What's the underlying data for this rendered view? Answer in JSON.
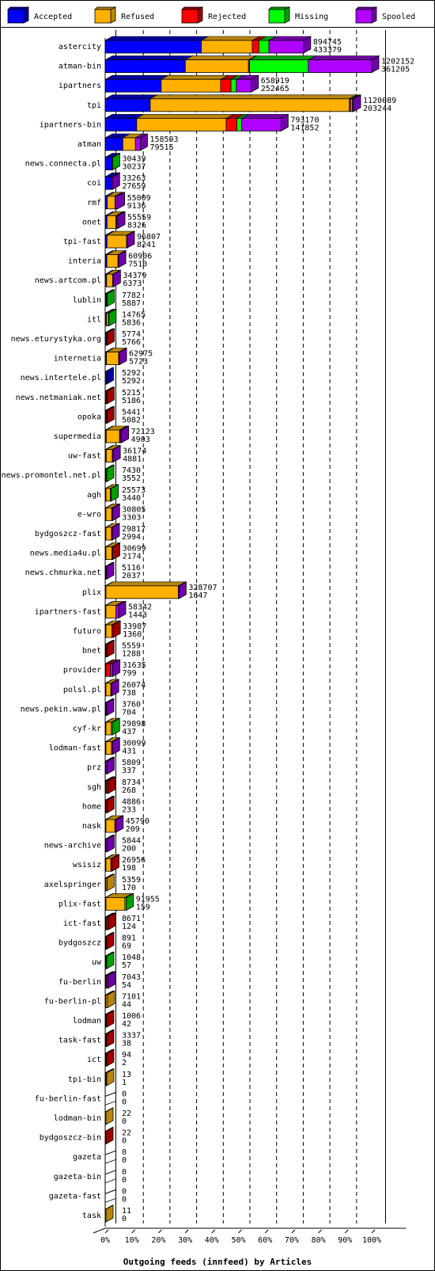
{
  "chart_data": {
    "type": "bar",
    "orientation": "horizontal",
    "stacked": true,
    "title": "",
    "xlabel": "Outgoing feeds (innfeed) by Articles",
    "ylabel": "",
    "x_unit": "percent of maximum total",
    "xlim": [
      0,
      100
    ],
    "x_ticks": [
      "0%",
      "10%",
      "20%",
      "30%",
      "40%",
      "50%",
      "60%",
      "70%",
      "80%",
      "90%",
      "100%"
    ],
    "grid": true,
    "legend_position": "top",
    "legend": [
      {
        "name": "Accepted",
        "color": "#0000ff",
        "shade": "#0000a0"
      },
      {
        "name": "Refused",
        "color": "#ffb000",
        "shade": "#b8860b"
      },
      {
        "name": "Rejected",
        "color": "#ff0000",
        "shade": "#a00000"
      },
      {
        "name": "Missing",
        "color": "#00ff00",
        "shade": "#00a000"
      },
      {
        "name": "Spooled",
        "color": "#b000ff",
        "shade": "#7000a8"
      }
    ],
    "max_total": 1202152,
    "categories": [
      {
        "name": "astercity",
        "top": "894745",
        "bottom": "433379",
        "seg": [
          433379,
          230000,
          30000,
          45000,
          156366
        ]
      },
      {
        "name": "atman-bin",
        "top": "1202152",
        "bottom": "361205",
        "seg": [
          361205,
          285000,
          5000,
          265000,
          285947
        ]
      },
      {
        "name": "ipartners",
        "top": "658919",
        "bottom": "252465",
        "seg": [
          252465,
          268000,
          47000,
          24000,
          67454
        ]
      },
      {
        "name": "tpi",
        "top": "1120089",
        "bottom": "203244",
        "seg": [
          203244,
          898000,
          6000,
          8000,
          4845
        ]
      },
      {
        "name": "ipartners-bin",
        "top": "793170",
        "bottom": "141852",
        "seg": [
          141852,
          404000,
          48000,
          21000,
          178318
        ]
      },
      {
        "name": "atman",
        "top": "158593",
        "bottom": "79515",
        "seg": [
          79515,
          57000,
          0,
          0,
          22078
        ]
      },
      {
        "name": "news.connecta.pl",
        "top": "30439",
        "bottom": "30237",
        "seg": [
          30237,
          0,
          0,
          202,
          0
        ]
      },
      {
        "name": "coi",
        "top": "33263",
        "bottom": "27659",
        "seg": [
          27659,
          0,
          0,
          0,
          5604
        ]
      },
      {
        "name": "rmf",
        "top": "55009",
        "bottom": "9136",
        "seg": [
          9136,
          35000,
          3000,
          0,
          7873
        ]
      },
      {
        "name": "onet",
        "top": "55559",
        "bottom": "8326",
        "seg": [
          8326,
          40000,
          2000,
          0,
          5233
        ]
      },
      {
        "name": "tpi-fast",
        "top": "96807",
        "bottom": "8241",
        "seg": [
          8241,
          88000,
          0,
          0,
          566
        ]
      },
      {
        "name": "interia",
        "top": "60906",
        "bottom": "7510",
        "seg": [
          7510,
          50000,
          0,
          0,
          3396
        ]
      },
      {
        "name": "news.artcom.pl",
        "top": "34379",
        "bottom": "6373",
        "seg": [
          6373,
          27000,
          0,
          0,
          1006
        ]
      },
      {
        "name": "lublin",
        "top": "7782",
        "bottom": "5887",
        "seg": [
          5887,
          0,
          0,
          1895,
          0
        ]
      },
      {
        "name": "itl",
        "top": "14765",
        "bottom": "5836",
        "seg": [
          5836,
          8000,
          0,
          929,
          0
        ]
      },
      {
        "name": "news.eturystyka.org",
        "top": "5774",
        "bottom": "5766",
        "seg": [
          5766,
          0,
          8,
          0,
          0
        ]
      },
      {
        "name": "internetia",
        "top": "62975",
        "bottom": "5723",
        "seg": [
          5723,
          55000,
          0,
          0,
          2252
        ]
      },
      {
        "name": "news.intertele.pl",
        "top": "5292",
        "bottom": "5292",
        "seg": [
          5292,
          0,
          0,
          0,
          0
        ]
      },
      {
        "name": "news.netmaniak.net",
        "top": "5215",
        "bottom": "5186",
        "seg": [
          5186,
          0,
          29,
          0,
          0
        ]
      },
      {
        "name": "opoka",
        "top": "5441",
        "bottom": "5082",
        "seg": [
          5082,
          0,
          359,
          0,
          0
        ]
      },
      {
        "name": "supermedia",
        "top": "72123",
        "bottom": "4903",
        "seg": [
          4903,
          60000,
          2000,
          0,
          5220
        ]
      },
      {
        "name": "uw-fast",
        "top": "36174",
        "bottom": "4881",
        "seg": [
          4881,
          27000,
          0,
          0,
          4293
        ]
      },
      {
        "name": "news.promontel.net.pl",
        "top": "7430",
        "bottom": "3552",
        "seg": [
          3552,
          0,
          0,
          3878,
          0
        ]
      },
      {
        "name": "agh",
        "top": "25573",
        "bottom": "3440",
        "seg": [
          3440,
          20000,
          0,
          2133,
          0
        ]
      },
      {
        "name": "e-wro",
        "top": "30805",
        "bottom": "3303",
        "seg": [
          3303,
          26000,
          0,
          0,
          1502
        ]
      },
      {
        "name": "bydgoszcz-fast",
        "top": "29817",
        "bottom": "2994",
        "seg": [
          2994,
          25000,
          0,
          0,
          1823
        ]
      },
      {
        "name": "news.media4u.pl",
        "top": "30699",
        "bottom": "2174",
        "seg": [
          2174,
          27000,
          1525,
          0,
          0
        ]
      },
      {
        "name": "news.chmurka.net",
        "top": "5116",
        "bottom": "2037",
        "seg": [
          2037,
          0,
          0,
          0,
          3079
        ]
      },
      {
        "name": "plix",
        "top": "328707",
        "bottom": "1647",
        "seg": [
          1647,
          326000,
          0,
          0,
          1060
        ]
      },
      {
        "name": "ipartners-fast",
        "top": "58342",
        "bottom": "1443",
        "seg": [
          1443,
          45000,
          0,
          0,
          11899
        ]
      },
      {
        "name": "futuro",
        "top": "33987",
        "bottom": "1360",
        "seg": [
          1360,
          27000,
          5627,
          0,
          0
        ]
      },
      {
        "name": "bnet",
        "top": "5559",
        "bottom": "1288",
        "seg": [
          1288,
          0,
          4271,
          0,
          0
        ]
      },
      {
        "name": "provider",
        "top": "31635",
        "bottom": "799",
        "seg": [
          799,
          0,
          20000,
          0,
          10836
        ]
      },
      {
        "name": "polsl.pl",
        "top": "26074",
        "bottom": "738",
        "seg": [
          738,
          22000,
          0,
          0,
          3336
        ]
      },
      {
        "name": "news.pekin.waw.pl",
        "top": "3760",
        "bottom": "704",
        "seg": [
          704,
          0,
          0,
          0,
          3056
        ]
      },
      {
        "name": "cyf-kr",
        "top": "29898",
        "bottom": "437",
        "seg": [
          437,
          24000,
          0,
          5461,
          0
        ]
      },
      {
        "name": "lodman-fast",
        "top": "30099",
        "bottom": "431",
        "seg": [
          431,
          25000,
          0,
          0,
          4668
        ]
      },
      {
        "name": "prz",
        "top": "5809",
        "bottom": "337",
        "seg": [
          337,
          0,
          0,
          0,
          5472
        ]
      },
      {
        "name": "sgh",
        "top": "8734",
        "bottom": "268",
        "seg": [
          268,
          1500,
          6966,
          0,
          0
        ]
      },
      {
        "name": "home",
        "top": "4886",
        "bottom": "233",
        "seg": [
          233,
          0,
          4653,
          0,
          0
        ]
      },
      {
        "name": "nask",
        "top": "45790",
        "bottom": "209",
        "seg": [
          209,
          40000,
          0,
          0,
          5581
        ]
      },
      {
        "name": "news-archive",
        "top": "5844",
        "bottom": "200",
        "seg": [
          200,
          0,
          0,
          0,
          5644
        ]
      },
      {
        "name": "wsisiz",
        "top": "26956",
        "bottom": "198",
        "seg": [
          198,
          22000,
          4758,
          0,
          0
        ]
      },
      {
        "name": "axelspringer",
        "top": "5359",
        "bottom": "170",
        "seg": [
          170,
          5189,
          0,
          0,
          0
        ]
      },
      {
        "name": "plix-fast",
        "top": "91955",
        "bottom": "159",
        "seg": [
          159,
          85000,
          0,
          6796,
          0
        ]
      },
      {
        "name": "ict-fast",
        "top": "8671",
        "bottom": "124",
        "seg": [
          124,
          1000,
          7547,
          0,
          0
        ]
      },
      {
        "name": "bydgoszcz",
        "top": "891",
        "bottom": "69",
        "seg": [
          69,
          0,
          822,
          0,
          0
        ]
      },
      {
        "name": "uw",
        "top": "1048",
        "bottom": "57",
        "seg": [
          57,
          0,
          0,
          991,
          0
        ]
      },
      {
        "name": "fu-berlin",
        "top": "7043",
        "bottom": "54",
        "seg": [
          54,
          500,
          0,
          0,
          6489
        ]
      },
      {
        "name": "fu-berlin-pl",
        "top": "7101",
        "bottom": "44",
        "seg": [
          44,
          7057,
          0,
          0,
          0
        ]
      },
      {
        "name": "lodman",
        "top": "1006",
        "bottom": "42",
        "seg": [
          42,
          0,
          964,
          0,
          0
        ]
      },
      {
        "name": "task-fast",
        "top": "3337",
        "bottom": "38",
        "seg": [
          38,
          0,
          3299,
          0,
          0
        ]
      },
      {
        "name": "ict",
        "top": "94",
        "bottom": "2",
        "seg": [
          2,
          0,
          92,
          0,
          0
        ]
      },
      {
        "name": "tpi-bin",
        "top": "13",
        "bottom": "1",
        "seg": [
          1,
          12,
          0,
          0,
          0
        ]
      },
      {
        "name": "fu-berlin-fast",
        "top": "0",
        "bottom": "0",
        "seg": [
          0,
          0,
          0,
          0,
          0
        ]
      },
      {
        "name": "lodman-bin",
        "top": "22",
        "bottom": "0",
        "seg": [
          0,
          22,
          0,
          0,
          0
        ]
      },
      {
        "name": "bydgoszcz-bin",
        "top": "22",
        "bottom": "0",
        "seg": [
          0,
          0,
          22,
          0,
          0
        ]
      },
      {
        "name": "gazeta",
        "top": "0",
        "bottom": "0",
        "seg": [
          0,
          0,
          0,
          0,
          0
        ]
      },
      {
        "name": "gazeta-bin",
        "top": "0",
        "bottom": "0",
        "seg": [
          0,
          0,
          0,
          0,
          0
        ]
      },
      {
        "name": "gazeta-fast",
        "top": "0",
        "bottom": "0",
        "seg": [
          0,
          0,
          0,
          0,
          0
        ]
      },
      {
        "name": "task",
        "top": "11",
        "bottom": "0",
        "seg": [
          0,
          11,
          0,
          0,
          0
        ]
      }
    ]
  }
}
